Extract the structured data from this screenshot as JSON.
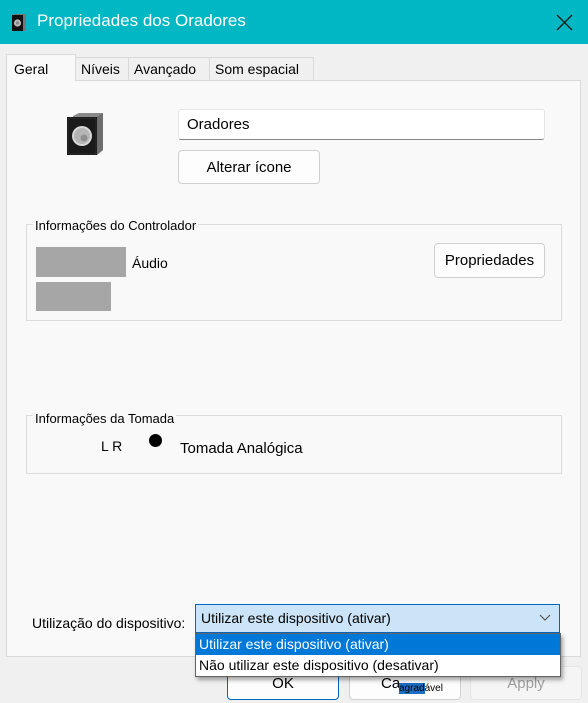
{
  "window": {
    "title": "Propriedades dos Oradores",
    "title_icon": "speaker-icon",
    "close_icon": "close-icon",
    "accent_color": "#00b7c3"
  },
  "tabs": [
    {
      "label": "Geral",
      "active": true
    },
    {
      "label": "Níveis",
      "active": false
    },
    {
      "label": "Avançado",
      "active": false
    },
    {
      "label": "Som espacial",
      "active": false
    }
  ],
  "general": {
    "device_icon": "speaker-icon",
    "device_name": "Oradores",
    "change_icon_label": "Alterar ícone",
    "controller_group": {
      "label": "Informações do Controlador",
      "line1_suffix": "Áudio",
      "properties_label": "Propriedades"
    },
    "jack_group": {
      "label": "Informações da Tomada",
      "channels": "L R",
      "jack_color": "#000000",
      "jack_name": "Tomada Analógica"
    },
    "device_usage": {
      "label": "Utilização do dispositivo:",
      "selected": "Utilizar este dispositivo (ativar)",
      "options": [
        {
          "label": "Utilizar este dispositivo (ativar)",
          "highlighted": true
        },
        {
          "label": "Não utilizar este dispositivo (desativar)",
          "highlighted": false
        }
      ]
    }
  },
  "footer": {
    "ok_label": "OK",
    "cancel_label_visible": "Ca",
    "overlay_text_highlight": "agrad",
    "overlay_text_rest": "ável",
    "apply_label": "Apply"
  }
}
